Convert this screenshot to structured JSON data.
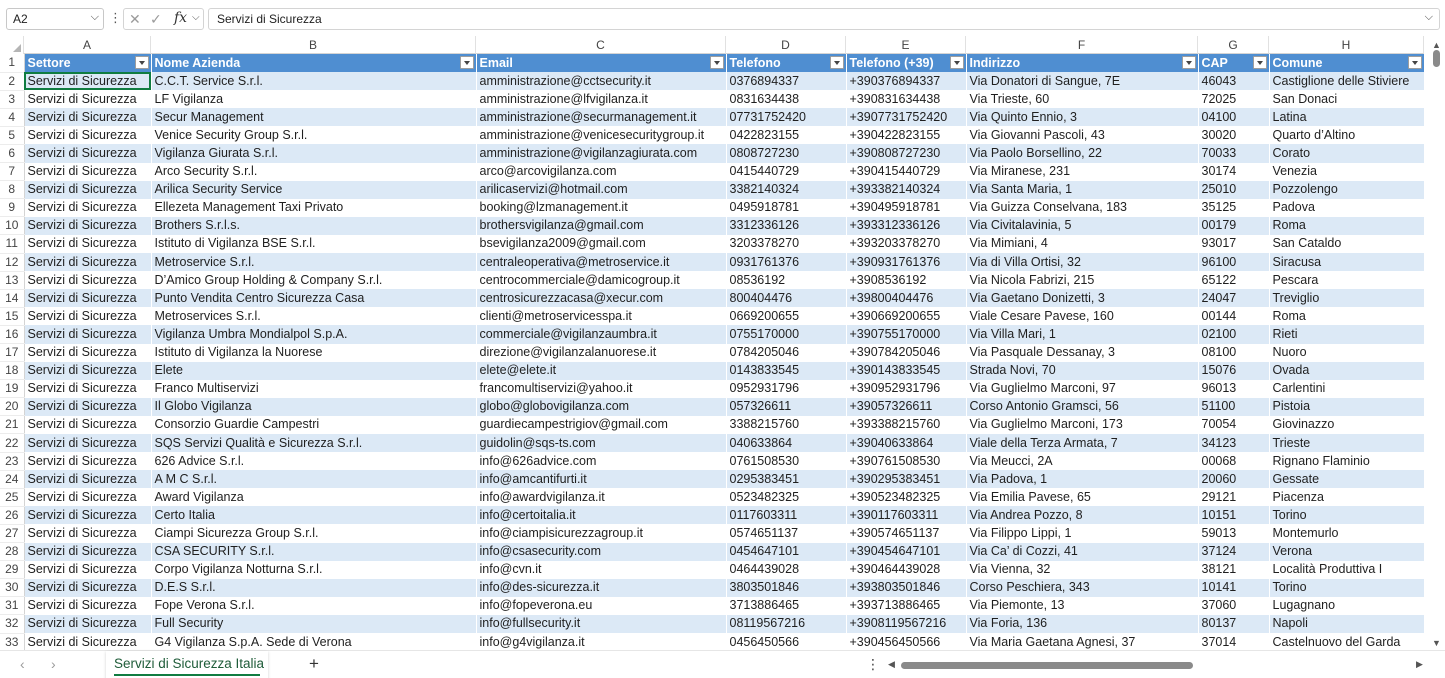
{
  "formula_bar": {
    "name_box": "A2",
    "formula": "Servizi di Sicurezza",
    "fx_label": "fx"
  },
  "columns": [
    {
      "letter": "A"
    },
    {
      "letter": "B"
    },
    {
      "letter": "C"
    },
    {
      "letter": "D"
    },
    {
      "letter": "E"
    },
    {
      "letter": "F"
    },
    {
      "letter": "G"
    },
    {
      "letter": "H"
    }
  ],
  "header_row": [
    "Settore",
    "Nome Azienda",
    "Email",
    "Telefono",
    "Telefono (+39)",
    "Indirizzo",
    "CAP",
    "Comune"
  ],
  "rows": [
    [
      "Servizi di Sicurezza",
      "C.C.T. Service S.r.l.",
      "amministrazione@cctsecurity.it",
      "0376894337",
      "+390376894337",
      "Via Donatori di Sangue, 7E",
      "46043",
      "Castiglione delle Stiviere"
    ],
    [
      "Servizi di Sicurezza",
      "LF Vigilanza",
      "amministrazione@lfvigilanza.it",
      "0831634438",
      "+390831634438",
      "Via Trieste, 60",
      "72025",
      "San Donaci"
    ],
    [
      "Servizi di Sicurezza",
      "Secur Management",
      "amministrazione@securmanagement.it",
      "07731752420",
      "+3907731752420",
      "Via Quinto Ennio, 3",
      "04100",
      "Latina"
    ],
    [
      "Servizi di Sicurezza",
      "Venice Security Group S.r.l.",
      "amministrazione@venicesecuritygroup.it",
      "0422823155",
      "+390422823155",
      "Via Giovanni Pascoli, 43",
      "30020",
      "Quarto d’Altino"
    ],
    [
      "Servizi di Sicurezza",
      "Vigilanza Giurata S.r.l.",
      "amministrazione@vigilanzagiurata.com",
      "0808727230",
      "+390808727230",
      "Via Paolo Borsellino, 22",
      "70033",
      "Corato"
    ],
    [
      "Servizi di Sicurezza",
      "Arco Security S.r.l.",
      "arco@arcovigilanza.com",
      "0415440729",
      "+390415440729",
      "Via Miranese, 231",
      "30174",
      "Venezia"
    ],
    [
      "Servizi di Sicurezza",
      "Arilica Security Service",
      "arilicaservizi@hotmail.com",
      "3382140324",
      "+393382140324",
      "Via Santa Maria, 1",
      "25010",
      "Pozzolengo"
    ],
    [
      "Servizi di Sicurezza",
      "Ellezeta Management Taxi Privato",
      "booking@lzmanagement.it",
      "0495918781",
      "+390495918781",
      "Via Guizza Conselvana, 183",
      "35125",
      "Padova"
    ],
    [
      "Servizi di Sicurezza",
      "Brothers S.r.l.s.",
      "brothersvigilanza@gmail.com",
      "3312336126",
      "+393312336126",
      "Via Civitalavinia, 5",
      "00179",
      "Roma"
    ],
    [
      "Servizi di Sicurezza",
      "Istituto di Vigilanza BSE S.r.l.",
      "bsevigilanza2009@gmail.com",
      "3203378270",
      "+393203378270",
      "Via Mimiani, 4",
      "93017",
      "San Cataldo"
    ],
    [
      "Servizi di Sicurezza",
      "Metroservice S.r.l.",
      "centraleoperativa@metroservice.it",
      "0931761376",
      "+390931761376",
      "Via di Villa Ortisi, 32",
      "96100",
      "Siracusa"
    ],
    [
      "Servizi di Sicurezza",
      "D’Amico Group Holding & Company S.r.l.",
      "centrocommerciale@damicogroup.it",
      "08536192",
      "+3908536192",
      "Via Nicola Fabrizi, 215",
      "65122",
      "Pescara"
    ],
    [
      "Servizi di Sicurezza",
      "Punto Vendita Centro Sicurezza Casa",
      "centrosicurezzacasa@xecur.com",
      "800404476",
      "+39800404476",
      "Via Gaetano Donizetti, 3",
      "24047",
      "Treviglio"
    ],
    [
      "Servizi di Sicurezza",
      "Metroservices S.r.l.",
      "clienti@metroservicesspa.it",
      "0669200655",
      "+390669200655",
      "Viale Cesare Pavese, 160",
      "00144",
      "Roma"
    ],
    [
      "Servizi di Sicurezza",
      "Vigilanza Umbra Mondialpol S.p.A.",
      "commerciale@vigilanzaumbra.it",
      "0755170000",
      "+390755170000",
      "Via Villa Mari, 1",
      "02100",
      "Rieti"
    ],
    [
      "Servizi di Sicurezza",
      "Istituto di Vigilanza la Nuorese",
      "direzione@vigilanzalanuorese.it",
      "0784205046",
      "+390784205046",
      "Via Pasquale Dessanay, 3",
      "08100",
      "Nuoro"
    ],
    [
      "Servizi di Sicurezza",
      "Elete",
      "elete@elete.it",
      "0143833545",
      "+390143833545",
      "Strada Novi, 70",
      "15076",
      "Ovada"
    ],
    [
      "Servizi di Sicurezza",
      "Franco Multiservizi",
      "francomultiservizi@yahoo.it",
      "0952931796",
      "+390952931796",
      "Via Guglielmo Marconi, 97",
      "96013",
      "Carlentini"
    ],
    [
      "Servizi di Sicurezza",
      "Il Globo Vigilanza",
      "globo@globovigilanza.com",
      "057326611",
      "+39057326611",
      "Corso Antonio Gramsci, 56",
      "51100",
      "Pistoia"
    ],
    [
      "Servizi di Sicurezza",
      "Consorzio Guardie Campestri",
      "guardiecampestrigiov@gmail.com",
      "3388215760",
      "+393388215760",
      "Via Guglielmo Marconi, 173",
      "70054",
      "Giovinazzo"
    ],
    [
      "Servizi di Sicurezza",
      "SQS Servizi Qualità e Sicurezza S.r.l.",
      "guidolin@sqs-ts.com",
      "040633864",
      "+39040633864",
      "Viale della Terza Armata, 7",
      "34123",
      "Trieste"
    ],
    [
      "Servizi di Sicurezza",
      "626 Advice S.r.l.",
      "info@626advice.com",
      "0761508530",
      "+390761508530",
      "Via Meucci, 2A",
      "00068",
      "Rignano Flaminio"
    ],
    [
      "Servizi di Sicurezza",
      "A M C S.r.l.",
      "info@amcantifurti.it",
      "0295383451",
      "+390295383451",
      "Via Padova, 1",
      "20060",
      "Gessate"
    ],
    [
      "Servizi di Sicurezza",
      "Award Vigilanza",
      "info@awardvigilanza.it",
      "0523482325",
      "+390523482325",
      "Via Emilia Pavese, 65",
      "29121",
      "Piacenza"
    ],
    [
      "Servizi di Sicurezza",
      "Certo Italia",
      "info@certoitalia.it",
      "0117603311",
      "+390117603311",
      "Via Andrea Pozzo, 8",
      "10151",
      "Torino"
    ],
    [
      "Servizi di Sicurezza",
      "Ciampi Sicurezza Group S.r.l.",
      "info@ciampisicurezzagroup.it",
      "0574651137",
      "+390574651137",
      "Via Filippo Lippi, 1",
      "59013",
      "Montemurlo"
    ],
    [
      "Servizi di Sicurezza",
      "CSA SECURITY S.r.l.",
      "info@csasecurity.com",
      "0454647101",
      "+390454647101",
      "Via Ca’ di Cozzi, 41",
      "37124",
      "Verona"
    ],
    [
      "Servizi di Sicurezza",
      "Corpo Vigilanza Notturna S.r.l.",
      "info@cvn.it",
      "0464439028",
      "+390464439028",
      "Via Vienna, 32",
      "38121",
      "Località Produttiva I"
    ],
    [
      "Servizi di Sicurezza",
      "D.E.S S.r.l.",
      "info@des-sicurezza.it",
      "3803501846",
      "+393803501846",
      "Corso Peschiera, 343",
      "10141",
      "Torino"
    ],
    [
      "Servizi di Sicurezza",
      "Fope Verona S.r.l.",
      "info@fopeverona.eu",
      "3713886465",
      "+393713886465",
      "Via Piemonte, 13",
      "37060",
      "Lugagnano"
    ],
    [
      "Servizi di Sicurezza",
      "Full Security",
      "info@fullsecurity.it",
      "08119567216",
      "+3908119567216",
      "Via Foria, 136",
      "80137",
      "Napoli"
    ],
    [
      "Servizi di Sicurezza",
      "G4 Vigilanza S.p.A. Sede di Verona",
      "info@g4vigilanza.it",
      "0456450566",
      "+390456450566",
      "Via Maria Gaetana Agnesi, 37",
      "37014",
      "Castelnuovo del Garda"
    ]
  ],
  "tabs": {
    "active_sheet": "Servizi di Sicurezza Italia",
    "add_label": "+"
  },
  "colors": {
    "header_fill": "#4f8ed1",
    "band_fill": "#dce9f6",
    "accent": "#107c41"
  }
}
